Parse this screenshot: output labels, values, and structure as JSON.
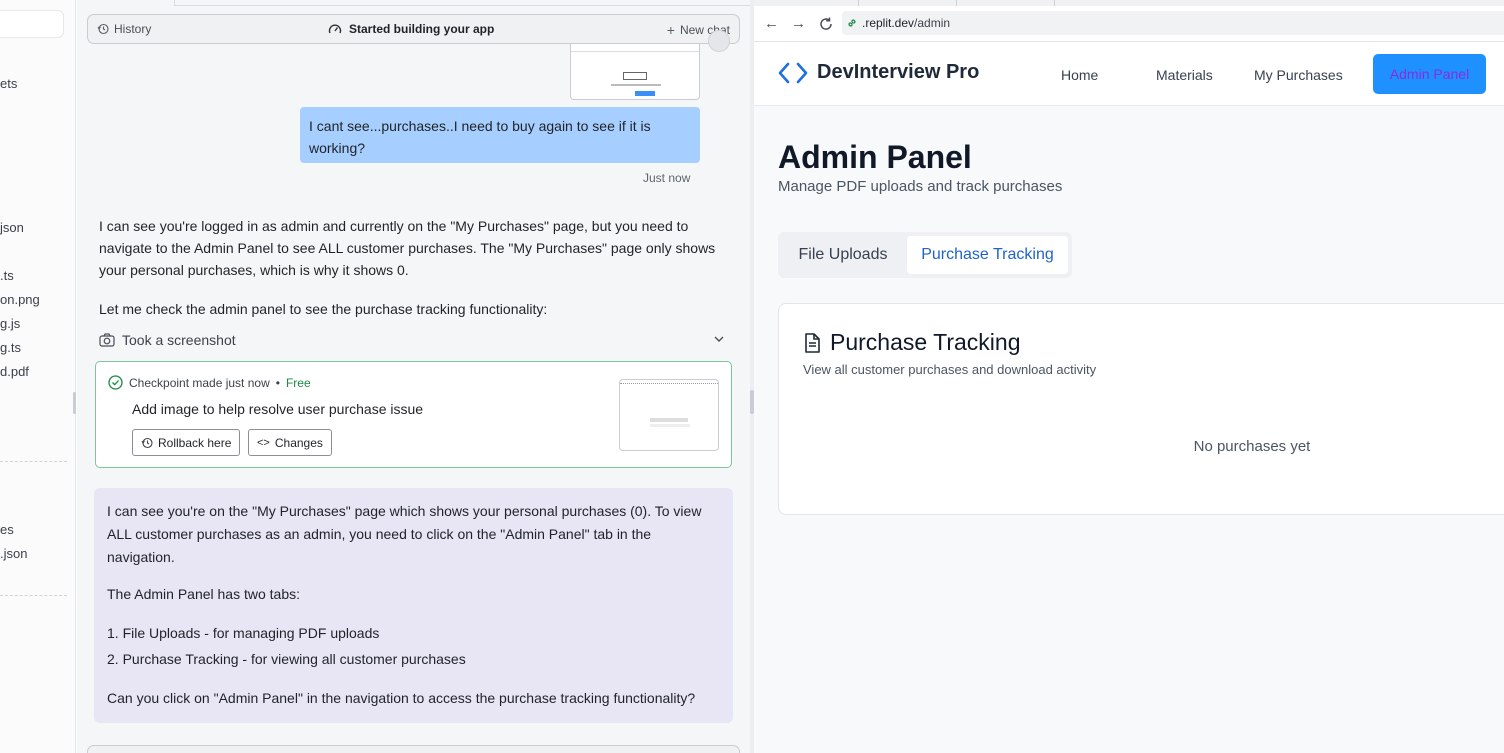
{
  "filetree": {
    "items": [
      "ets",
      "json",
      ".ts",
      "on.png",
      "g.js",
      "g.ts",
      "d.pdf",
      "es",
      ".json"
    ]
  },
  "chat": {
    "header": {
      "history_label": "History",
      "title": "Started building your app",
      "new_chat_label": "New chat"
    },
    "user_message": "I cant see...purchases..I need to buy again to see if it is working?",
    "user_time": "Just now",
    "ai_paragraph_1": "I can see you're logged in as admin and currently on the \"My Purchases\" page, but you need to navigate to the Admin Panel to see ALL customer purchases. The \"My Purchases\" page only shows your personal purchases, which is why it shows 0.",
    "ai_paragraph_2": "Let me check the admin panel to see the purchase tracking functionality:",
    "screenshot_label": "Took a screenshot",
    "checkpoint": {
      "label": "Checkpoint made just now",
      "dot": "•",
      "price": "Free",
      "message": "Add image to help resolve user purchase issue",
      "rollback_label": "Rollback here",
      "changes_label": "Changes"
    },
    "ai_block": {
      "p1": "I can see you're on the \"My Purchases\" page which shows your personal purchases (0). To view ALL customer purchases as an admin, you need to click on the \"Admin Panel\" tab in the navigation.",
      "p2": "The Admin Panel has two tabs:",
      "list": [
        "1. File Uploads - for managing PDF uploads",
        "2. Purchase Tracking - for viewing all customer purchases"
      ],
      "p3": "Can you click on \"Admin Panel\" in the navigation to access the purchase tracking functionality?"
    }
  },
  "browser": {
    "url_domain": ".replit.dev",
    "url_path": "/admin"
  },
  "site": {
    "brand": "DevInterview Pro",
    "nav": {
      "home": "Home",
      "materials": "Materials",
      "my_purchases": "My Purchases",
      "admin_panel": "Admin Panel"
    },
    "page_title": "Admin Panel",
    "page_subtitle": "Manage PDF uploads and track purchases",
    "tabs": {
      "file_uploads": "File Uploads",
      "purchase_tracking": "Purchase Tracking"
    },
    "card": {
      "title": "Purchase Tracking",
      "subtitle": "View all customer purchases and download activity",
      "empty": "No purchases yet"
    }
  },
  "colors": {
    "accent": "#1e90ff",
    "user_bubble": "#a6ceff",
    "ai_block": "#e8e5f5",
    "checkpoint_border": "#7fc59a",
    "free": "#1a8a43",
    "active_tab": "#1f63c6"
  }
}
